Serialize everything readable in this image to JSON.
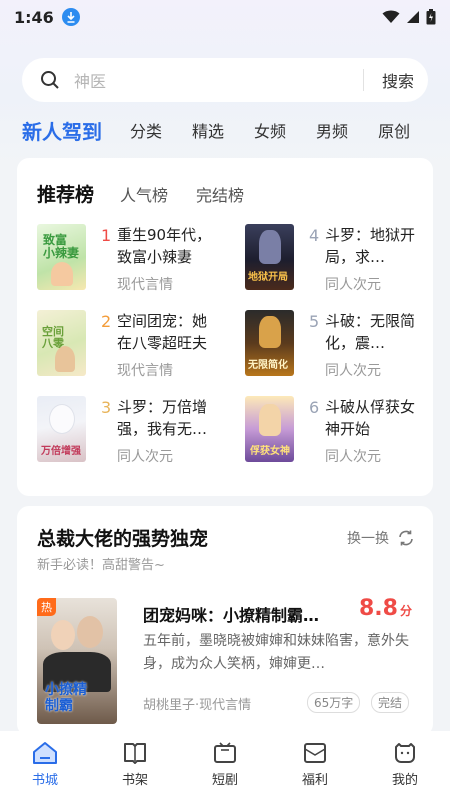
{
  "status": {
    "time": "1:46"
  },
  "search": {
    "placeholder": "神医",
    "button": "搜索"
  },
  "tabs": [
    "新人驾到",
    "分类",
    "精选",
    "女频",
    "男频",
    "原创"
  ],
  "ranking": {
    "tabs": [
      "推荐榜",
      "人气榜",
      "完结榜"
    ],
    "items": [
      {
        "rank": "1",
        "title": "重生90年代，致富小辣妻",
        "genre": "现代言情"
      },
      {
        "rank": "2",
        "title": "空间团宠：她在八零超旺夫",
        "genre": "现代言情"
      },
      {
        "rank": "3",
        "title": "斗罗：万倍增强，我有无…",
        "genre": "同人次元"
      },
      {
        "rank": "4",
        "title": "斗罗：地狱开局，求…",
        "genre": "同人次元"
      },
      {
        "rank": "5",
        "title": "斗破：无限简化，震…",
        "genre": "同人次元"
      },
      {
        "rank": "6",
        "title": "斗破从俘获女神开始",
        "genre": "同人次元"
      }
    ]
  },
  "section": {
    "title": "总裁大佬的强势独宠",
    "subtitle": "新手必读！高甜警告~",
    "refresh": "换一换",
    "book": {
      "badge": "热",
      "title": "团宠妈咪：小撩精制霸…",
      "score": "8.8",
      "score_unit": "分",
      "desc": "五年前，墨晓晓被婶婶和妹妹陷害，意外失身，成为众人笑柄，婶婶更…",
      "meta": "胡桃里子·现代言情",
      "tags": [
        "65万字",
        "完结"
      ]
    }
  },
  "nav": [
    "书城",
    "书架",
    "短剧",
    "福利",
    "我的"
  ],
  "colors": {
    "accent": "#2a6de8",
    "rank_red": "#ef4b46",
    "rank_orange": "#f39c3a",
    "rank_yellow": "#e8b45a",
    "rank_gray": "#9aa3b5"
  }
}
